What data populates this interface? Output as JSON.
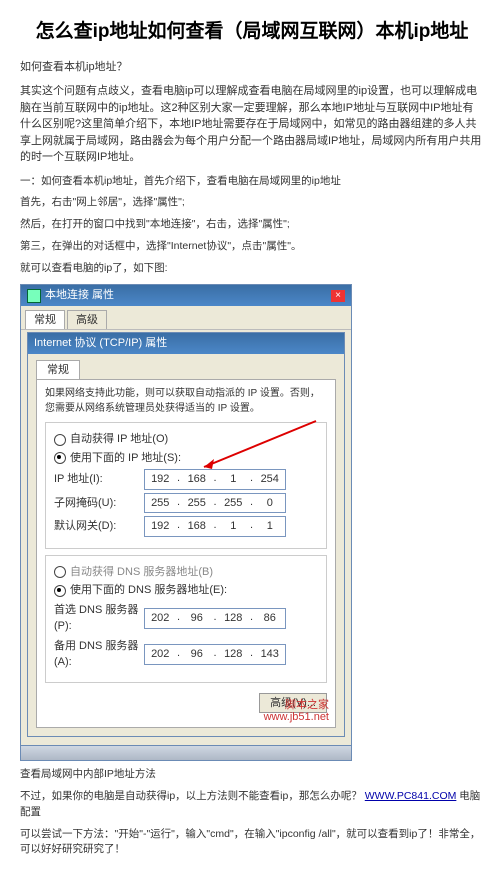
{
  "title": "怎么查ip地址如何查看（局域网互联网）本机ip地址",
  "intro_q": "如何查看本机ip地址？",
  "intro_body": "其实这个问题有点歧义，查看电脑ip可以理解成查看电脑在局域网里的ip设置，也可以理解成电脑在当前互联网中的ip地址。这2种区别大家一定要理解，那么本地IP地址与互联网中IP地址有什么区别呢?这里简单介绍下，本地IP地址需要存在于局域网中，如常见的路由器组建的多人共享上网就属于局域网，路由器会为每个用户分配一个路由器局域IP地址，局域网内所有用户共用的时一个互联网IP地址。",
  "step_title": "一：如何查看本机ip地址，首先介绍下，查看电脑在局域网里的ip地址",
  "step1": "首先，右击\"网上邻居\"，选择\"属性\";",
  "step2": "然后，在打开的窗口中找到\"本地连接\"，右击，选择\"属性\";",
  "step3": "第三，在弹出的对话框中，选择\"Internet协议\"，点击\"属性\"。",
  "step_result": "就可以查看电脑的ip了，如下图:",
  "caption": "查看局域网中内部IP地址方法",
  "post1_pre": "不过，如果你的电脑是自动获得ip，以上方法则不能查看ip，那怎么办呢？",
  "post1_link": "WWW.PC841.COM",
  "post1_post": "电脑配置",
  "post2": "可以尝试一下方法：\"开始\"-\"运行\"，输入\"cmd\"，在输入\"ipconfig /all\"，就可以查看到ip了！非常全，可以好好研究研究了！",
  "win": {
    "outer_title": "本地连接 属性",
    "tab1": "常规",
    "tab2": "高级",
    "inner_title": "Internet 协议 (TCP/IP) 属性",
    "inner_tab": "常规",
    "desc": "如果网络支持此功能，则可以获取自动指派的 IP 设置。否则，您需要从网络系统管理员处获得适当的 IP 设置。",
    "r_auto_ip": "自动获得 IP 地址(O)",
    "r_use_ip": "使用下面的 IP 地址(S):",
    "lbl_ip": "IP 地址(I):",
    "lbl_mask": "子网掩码(U):",
    "lbl_gw": "默认网关(D):",
    "ip": [
      "192",
      "168",
      "1",
      "254"
    ],
    "mask": [
      "255",
      "255",
      "255",
      "0"
    ],
    "gw": [
      "192",
      "168",
      "1",
      "1"
    ],
    "r_auto_dns": "自动获得 DNS 服务器地址(B)",
    "r_use_dns": "使用下面的 DNS 服务器地址(E):",
    "lbl_dns1": "首选 DNS 服务器(P):",
    "lbl_dns2": "备用 DNS 服务器(A):",
    "dns1": [
      "202",
      "96",
      "128",
      "86"
    ],
    "dns2": [
      "202",
      "96",
      "128",
      "143"
    ],
    "adv": "高级(V)...",
    "watermark1": "脚本之家",
    "watermark2": "www.jb51.net"
  }
}
